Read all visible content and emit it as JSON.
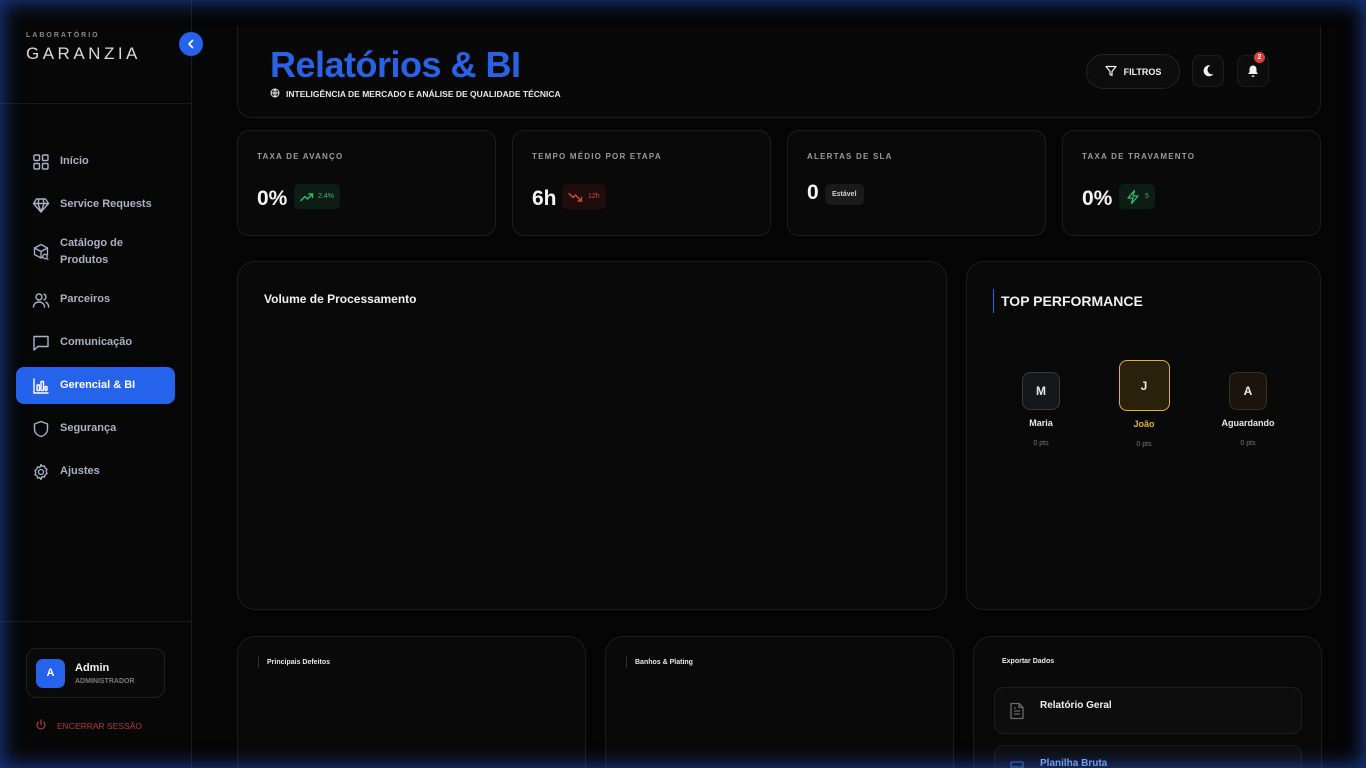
{
  "brand": {
    "small": "LABORATÓRIO",
    "name": "GARANZIA"
  },
  "nav": [
    {
      "label": "Início",
      "icon": "grid-icon",
      "active": false
    },
    {
      "label": "Service Requests",
      "icon": "diamond-icon",
      "active": false
    },
    {
      "label": "Catálogo de Produtos",
      "icon": "package-search-icon",
      "active": false
    },
    {
      "label": "Parceiros",
      "icon": "users-icon",
      "active": false
    },
    {
      "label": "Comunicação",
      "icon": "message-icon",
      "active": false
    },
    {
      "label": "Gerencial & BI",
      "icon": "bar-chart-icon",
      "active": true
    },
    {
      "label": "Segurança",
      "icon": "shield-icon",
      "active": false
    },
    {
      "label": "Ajustes",
      "icon": "gear-icon",
      "active": false
    }
  ],
  "user": {
    "initial": "A",
    "name": "Admin",
    "role": "ADMINISTRADOR"
  },
  "logout_label": "ENCERRAR SESSÃO",
  "header": {
    "title": "Relatórios & BI",
    "subtitle": "INTELIGÊNCIA DE MERCADO E ANÁLISE DE QUALIDADE TÉCNICA",
    "filter_label": "FILTROS",
    "notification_count": "2"
  },
  "kpis": [
    {
      "title": "TAXA DE AVANÇO",
      "value": "0%",
      "badge": "2.4%",
      "badge_icon": "trending-up-icon",
      "tone": "#2fbf71"
    },
    {
      "title": "TEMPO MÉDIO POR ETAPA",
      "value": "6h",
      "badge": "12h",
      "badge_icon": "trending-down-icon",
      "tone": "#d9463d"
    },
    {
      "title": "ALERTAS DE SLA",
      "value": "0",
      "badge": "Estável",
      "badge_icon": "",
      "tone": "#d0d0d0"
    },
    {
      "title": "TAXA DE TRAVAMENTO",
      "value": "0%",
      "badge": "5",
      "badge_icon": "lightning-icon",
      "tone": "#2fbf71"
    }
  ],
  "volume": {
    "title": "Volume de Processamento"
  },
  "top_performance": {
    "title": "TOP PERFORMANCE",
    "ranking": [
      {
        "initial": "M",
        "name": "Maria",
        "points": "0 pts"
      },
      {
        "initial": "J",
        "name": "João",
        "points": "0 pts"
      },
      {
        "initial": "A",
        "name": "Aguardando",
        "points": "0 pts"
      }
    ]
  },
  "bottom": {
    "defects_title": "Principais Defeitos",
    "plating_title": "Banhos & Plating",
    "export_title": "Exportar Dados",
    "export_items": [
      {
        "label": "Relatório Geral",
        "icon": "file-text-icon"
      },
      {
        "label": "Planilha Bruta",
        "icon": "spreadsheet-icon"
      }
    ]
  },
  "colors": {
    "accent": "#2563eb",
    "gold": "#e3b13a",
    "danger": "#d9463d",
    "success": "#2fbf71"
  }
}
